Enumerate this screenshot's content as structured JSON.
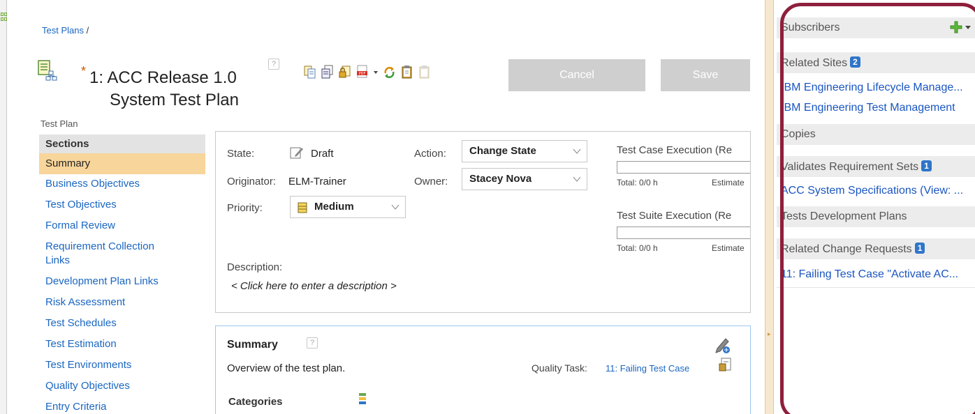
{
  "breadcrumb": {
    "link": "Test Plans",
    "separator": "/"
  },
  "plan": {
    "number": "1:",
    "title_line1": "ACC Release 1.0",
    "title_line2": "System Test Plan",
    "modified_marker": "*",
    "type_label": "Test Plan"
  },
  "buttons": {
    "cancel": "Cancel",
    "save": "Save"
  },
  "help_glyph": "?",
  "toolbar_icons": [
    "copy-icon",
    "duplicate-icon",
    "lock-icon",
    "pdf-export-icon",
    "sync-icon",
    "clipboard-icon",
    "paste-icon"
  ],
  "sections": {
    "header": "Sections",
    "items": [
      "Summary",
      "Business Objectives",
      "Test Objectives",
      "Formal Review",
      "Requirement Collection Links",
      "Development Plan Links",
      "Risk Assessment",
      "Test Schedules",
      "Test Estimation",
      "Test Environments",
      "Quality Objectives",
      "Entry Criteria"
    ],
    "active": "Summary"
  },
  "details": {
    "state_label": "State:",
    "state_value": "Draft",
    "action_label": "Action:",
    "action_value": "Change State",
    "originator_label": "Originator:",
    "originator_value": "ELM-Trainer",
    "owner_label": "Owner:",
    "owner_value": "Stacey Nova",
    "priority_label": "Priority:",
    "priority_value": "Medium",
    "description_label": "Description:",
    "description_placeholder": "< Click here to enter a description >",
    "tc_exec_title": "Test Case Execution (Re",
    "tc_total": "Total: 0/0 h",
    "tc_estimate": "Estimate",
    "ts_exec_title": "Test Suite Execution (Re",
    "ts_total": "Total: 0/0 h",
    "ts_estimate": "Estimate"
  },
  "summary": {
    "title": "Summary",
    "description": "Overview of the test plan.",
    "quality_task_label": "Quality Task:",
    "quality_task_link": "11: Failing Test Case",
    "categories_label": "Categories"
  },
  "right_panel": {
    "subscribers": "Subscribers",
    "related_sites": "Related Sites",
    "related_sites_count": "2",
    "related_site_links": [
      "IBM Engineering Lifecycle Manage...",
      "IBM Engineering Test Management"
    ],
    "copies": "Copies",
    "validates": "Validates Requirement Sets",
    "validates_count": "1",
    "validates_link": "ACC System Specifications (View: ...",
    "tests_dev_plans": "Tests Development Plans",
    "related_cr": "Related Change Requests",
    "related_cr_count": "1",
    "related_cr_link": "11: Failing Test Case \"Activate AC..."
  }
}
